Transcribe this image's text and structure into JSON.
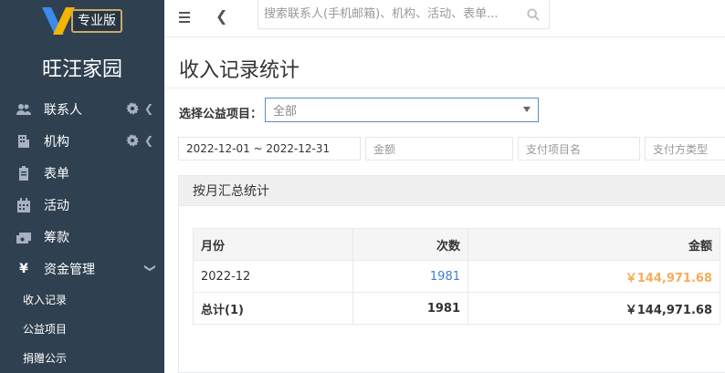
{
  "sidebar": {
    "logo_badge": "专业版",
    "org_name": "旺汪家园",
    "items": [
      {
        "label": "联系人",
        "icon": "users-icon",
        "has_tools": true
      },
      {
        "label": "机构",
        "icon": "building-icon",
        "has_tools": true
      },
      {
        "label": "表单",
        "icon": "clipboard-icon",
        "has_tools": false
      },
      {
        "label": "活动",
        "icon": "calendar-icon",
        "has_tools": false
      },
      {
        "label": "筹款",
        "icon": "money-icon",
        "has_tools": false
      },
      {
        "label": "资金管理",
        "icon": "yen-icon",
        "icon_text": "¥",
        "has_tools": false,
        "expanded": true
      }
    ],
    "sub_items": [
      {
        "label": "收入记录"
      },
      {
        "label": "公益项目"
      },
      {
        "label": "捐赠公示"
      }
    ]
  },
  "topbar": {
    "search_placeholder": "搜索联系人(手机邮箱)、机构、活动、表单..."
  },
  "main": {
    "title": "收入记录统计",
    "filter_label": "选择公益项目：",
    "project_select_value": "全部",
    "filters": {
      "date_range": "2022-12-01 ~ 2022-12-31",
      "amount_placeholder": "金额",
      "pay_item_placeholder": "支付项目名",
      "pay_type_placeholder": "支付方类型"
    },
    "panel_title": "按月汇总统计",
    "table": {
      "headers": [
        "月份",
        "次数",
        "金额"
      ],
      "rows": [
        {
          "month": "2022-12",
          "count": "1981",
          "amount": "￥144,971.68"
        }
      ],
      "total": {
        "label": "总计(1)",
        "count": "1981",
        "amount": "￥144,971.68"
      }
    }
  },
  "colors": {
    "sidebar_bg": "#2f4050",
    "link": "#3c7fd1",
    "amount": "#f8ac59",
    "select_border": "#5a8fbf"
  }
}
